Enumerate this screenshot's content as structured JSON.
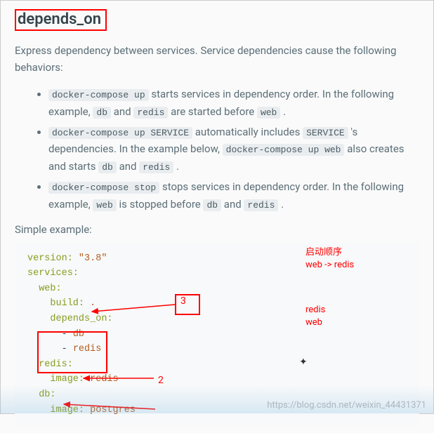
{
  "title": "depends_on",
  "intro": "Express dependency between services. Service dependencies cause the following behaviors:",
  "bullets": [
    {
      "pre": "",
      "code1": "docker-compose up",
      "mid1": " starts services in dependency order. In the following example, ",
      "code2": "db",
      "mid2": " and ",
      "code3": "redis",
      "mid3": " are started before ",
      "code4": "web",
      "tail": " ."
    },
    {
      "pre": "",
      "code1": "docker-compose up SERVICE",
      "mid1": " automatically includes ",
      "code2": "SERVICE",
      "mid2": " 's dependencies. In the example below, ",
      "code3": "docker-compose up web",
      "mid3": " also creates and starts ",
      "code4": "db",
      "mid4": " and ",
      "code5": "redis",
      "tail": " ."
    },
    {
      "pre": "",
      "code1": "docker-compose stop",
      "mid1": " stops services in dependency order. In the following example, ",
      "code2": "web",
      "mid2": " is stopped before ",
      "code3": "db",
      "mid3": " and ",
      "code4": "redis",
      "tail": " ."
    }
  ],
  "example_label": "Simple example:",
  "annotations": {
    "top1": "启动顺序",
    "top2": "web -> redis",
    "list1": "redis",
    "list2": "web",
    "num3": "3",
    "num2": "2",
    "cross": "✦"
  },
  "yaml": {
    "l1": "version:",
    "l1v": " \"3.8\"",
    "l2": "services:",
    "l3": "  web:",
    "l4": "    build:",
    "l4v": " .",
    "l5": "    depends_on:",
    "l6a": "      - ",
    "l6b": "db",
    "l7a": "      - ",
    "l7b": "redis",
    "l8": "  redis:",
    "l9": "    image:",
    "l9v": " redis",
    "l10": "  db:",
    "l11": "    image:",
    "l11v": " postgres"
  },
  "watermark": "https://blog.csdn.net/weixin_44431371"
}
